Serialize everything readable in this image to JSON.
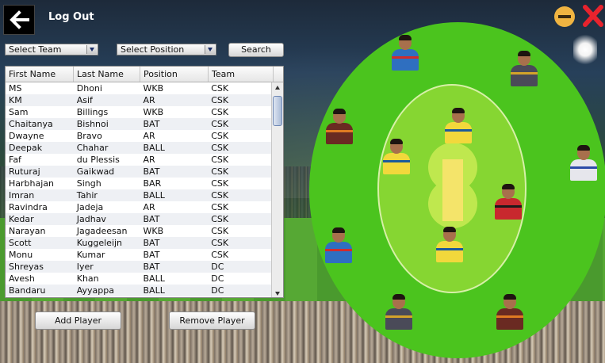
{
  "header": {
    "back_icon": "arrow-left-icon",
    "logout_label": "Log Out",
    "minimize_icon": "minimize-icon",
    "close_icon": "close-icon",
    "colors": {
      "minimize": "#f0b441",
      "close": "#e8232d"
    }
  },
  "filters": {
    "team_select": "Select Team",
    "position_select": "Select Position",
    "search_label": "Search"
  },
  "table": {
    "columns": [
      "First Name",
      "Last Name",
      "Position",
      "Team"
    ],
    "rows": [
      [
        "MS",
        "Dhoni",
        "WKB",
        "CSK"
      ],
      [
        "KM",
        "Asif",
        "AR",
        "CSK"
      ],
      [
        "Sam",
        "Billings",
        "WKB",
        "CSK"
      ],
      [
        "Chaitanya",
        "Bishnoi",
        "BAT",
        "CSK"
      ],
      [
        "Dwayne",
        "Bravo",
        "AR",
        "CSK"
      ],
      [
        "Deepak",
        "Chahar",
        "BALL",
        "CSK"
      ],
      [
        "Faf",
        "du Plessis",
        "AR",
        "CSK"
      ],
      [
        "Ruturaj",
        "Gaikwad",
        "BAT",
        "CSK"
      ],
      [
        "Harbhajan",
        "Singh",
        "BAR",
        "CSK"
      ],
      [
        "Imran",
        "Tahir",
        "BALL",
        "CSK"
      ],
      [
        "Ravindra",
        "Jadeja",
        "AR",
        "CSK"
      ],
      [
        "Kedar",
        "Jadhav",
        "BAT",
        "CSK"
      ],
      [
        "Narayan",
        "Jagadeesan",
        "WKB",
        "CSK"
      ],
      [
        "Scott",
        "Kuggeleijn",
        "BAT",
        "CSK"
      ],
      [
        "Monu",
        "Kumar",
        "BAT",
        "CSK"
      ],
      [
        "Shreyas",
        "Iyer",
        "BAT",
        "DC"
      ],
      [
        "Avesh",
        "Khan",
        "BALL",
        "DC"
      ],
      [
        "Bandaru",
        "Ayyappa",
        "BALL",
        "DC"
      ]
    ]
  },
  "actions": {
    "add_label": "Add Player",
    "remove_label": "Remove Player"
  },
  "field": {
    "colors": {
      "outfield": "#4bc41e",
      "inner": "#86d632",
      "pitch": "#f4e46a"
    },
    "players": [
      {
        "name": "player-1",
        "jersey": "#2f6fc0",
        "stripe": "#d12c2c"
      },
      {
        "name": "player-2",
        "jersey": "#4a4a58",
        "stripe": "#d4a32a"
      },
      {
        "name": "player-3",
        "jersey": "#6a2a22",
        "stripe": "#e07a22"
      },
      {
        "name": "player-4",
        "jersey": "#f2d83c",
        "stripe": "#1d5a9a"
      },
      {
        "name": "player-5",
        "jersey": "#f2d83c",
        "stripe": "#1d5a9a"
      },
      {
        "name": "player-6",
        "jersey": "#e6e6ec",
        "stripe": "#2c4ca8"
      },
      {
        "name": "player-7",
        "jersey": "#c8282e",
        "stripe": "#1a1a1a"
      },
      {
        "name": "player-8",
        "jersey": "#2f6fc0",
        "stripe": "#d12c2c"
      },
      {
        "name": "player-9",
        "jersey": "#f2d83c",
        "stripe": "#1d5a9a"
      },
      {
        "name": "player-10",
        "jersey": "#4a4a58",
        "stripe": "#d4a32a"
      },
      {
        "name": "player-11",
        "jersey": "#6a2a22",
        "stripe": "#e07a22"
      }
    ]
  }
}
